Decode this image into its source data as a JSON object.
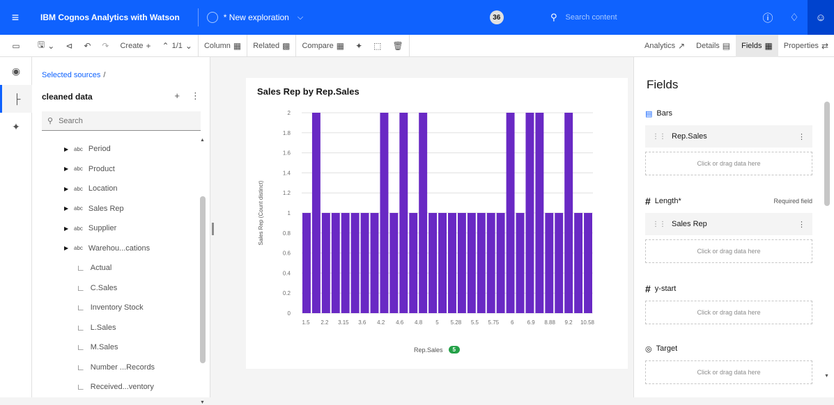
{
  "topbar": {
    "app_name": "IBM Cognos Analytics with Watson",
    "exploration": "* New exploration",
    "badge": "36",
    "search_placeholder": "Search content"
  },
  "toolbar": {
    "create": "Create",
    "page": "1/1",
    "column": "Column",
    "related": "Related",
    "compare": "Compare",
    "analytics": "Analytics",
    "details": "Details",
    "fields": "Fields",
    "properties": "Properties"
  },
  "sources": {
    "breadcrumb": "Selected sources",
    "breadcrumb_sep": "/",
    "dataset": "cleaned data",
    "search_placeholder": "Search",
    "dimensions": [
      "Period",
      "Product",
      "Location",
      "Sales Rep",
      "Supplier",
      "Warehou...cations"
    ],
    "measures": [
      "Actual",
      "C.Sales",
      "Inventory Stock",
      "L.Sales",
      "M.Sales",
      "Number ...Records",
      "Received...ventory"
    ]
  },
  "chart": {
    "title": "Sales Rep by Rep.Sales",
    "legend_label": "Rep.Sales",
    "legend_count": "5"
  },
  "chart_data": {
    "type": "bar",
    "title": "Sales Rep by Rep.Sales",
    "xlabel": "Rep.Sales",
    "ylabel": "Sales Rep (Count distinct)",
    "ylim": [
      0,
      2
    ],
    "yticks": [
      "0",
      "0.2",
      "0.4",
      "0.6",
      "0.8",
      "1",
      "1.2",
      "1.4",
      "1.6",
      "1.8",
      "2"
    ],
    "xticks": [
      "1.5",
      "2.2",
      "3.15",
      "3.6",
      "4.2",
      "4.6",
      "4.8",
      "5",
      "5.28",
      "5.5",
      "5.75",
      "6",
      "6.9",
      "8.88",
      "9.2",
      "10.58"
    ],
    "values": [
      1,
      2,
      1,
      1,
      1,
      1,
      1,
      1,
      2,
      1,
      2,
      1,
      2,
      1,
      1,
      1,
      1,
      1,
      1,
      1,
      1,
      2,
      1,
      2,
      2,
      1,
      1,
      2,
      1,
      1
    ],
    "color": "#6929c4",
    "grid": true
  },
  "fields": {
    "title": "Fields",
    "bars_label": "Bars",
    "bars_field": "Rep.Sales",
    "length_label": "Length*",
    "required": "Required field",
    "length_field": "Sales Rep",
    "ystart_label": "y-start",
    "target_label": "Target",
    "drop_hint": "Click or drag data here"
  }
}
